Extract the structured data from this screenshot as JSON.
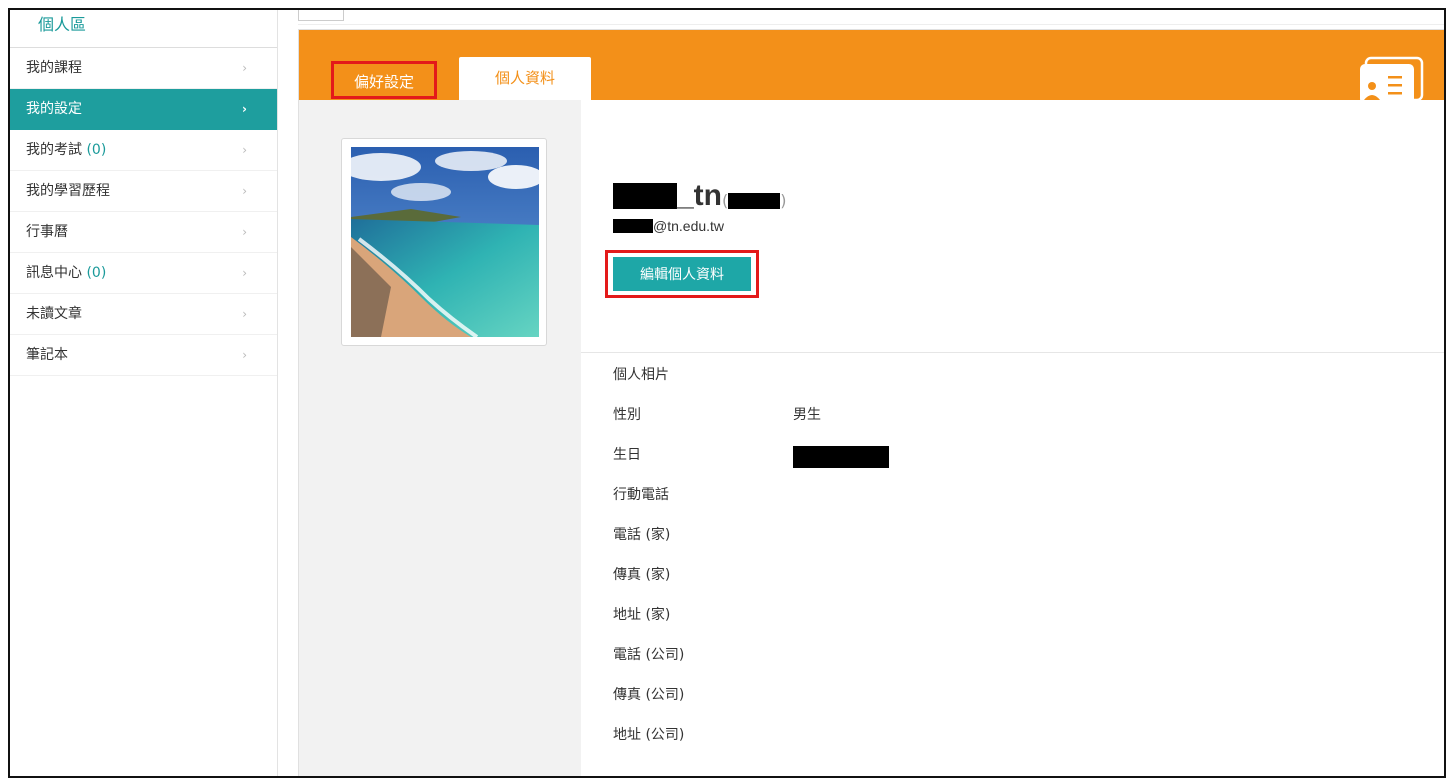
{
  "sidebar": {
    "title": "個人區",
    "items": [
      {
        "label": "我的課程",
        "count": "",
        "active": false
      },
      {
        "label": "我的設定",
        "count": "",
        "active": true
      },
      {
        "label": "我的考試 ",
        "count": "(0)",
        "active": false
      },
      {
        "label": "我的學習歷程",
        "count": "",
        "active": false
      },
      {
        "label": "行事曆",
        "count": "",
        "active": false
      },
      {
        "label": "訊息中心 ",
        "count": "(0)",
        "active": false
      },
      {
        "label": "未讀文章",
        "count": "",
        "active": false
      },
      {
        "label": "筆記本",
        "count": "",
        "active": false
      }
    ],
    "chevron": "›"
  },
  "tabs": {
    "preferences": "偏好設定",
    "profile": "個人資料"
  },
  "icons": {
    "card": "contact-card-icon",
    "profile_photo": "beach-photo"
  },
  "profile": {
    "username_suffix": "_tn",
    "paren_open": "(",
    "paren_close": ")",
    "email_suffix": "@tn.edu.tw",
    "edit_button": "編輯個人資料"
  },
  "info": [
    {
      "label": "個人相片",
      "value": ""
    },
    {
      "label": "性別",
      "value": "男生"
    },
    {
      "label": "生日",
      "value": ""
    },
    {
      "label": "行動電話",
      "value": ""
    },
    {
      "label": "電話 (家)",
      "value": ""
    },
    {
      "label": "傳真 (家)",
      "value": ""
    },
    {
      "label": "地址 (家)",
      "value": ""
    },
    {
      "label": "電話 (公司)",
      "value": ""
    },
    {
      "label": "傳真 (公司)",
      "value": ""
    },
    {
      "label": "地址 (公司)",
      "value": ""
    }
  ],
  "colors": {
    "accent_teal": "#1e9e9e",
    "tab_orange": "#f39019",
    "highlight_red": "#e31a1a"
  }
}
